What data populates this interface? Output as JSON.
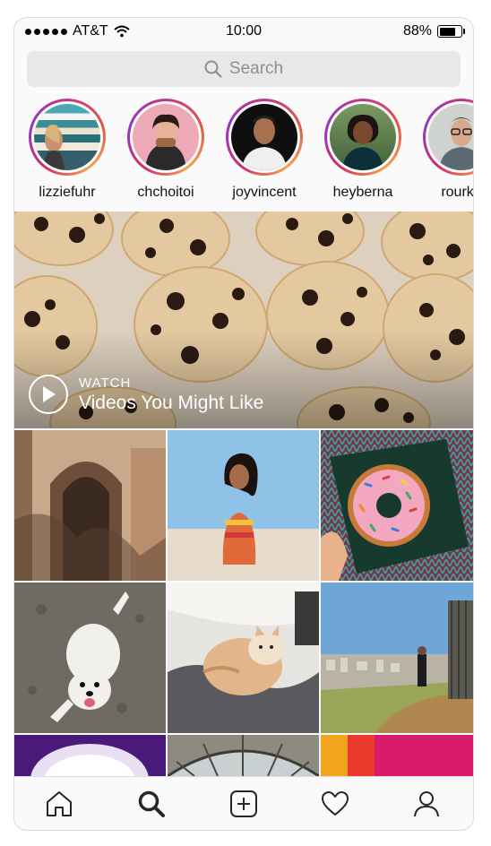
{
  "status_bar": {
    "carrier": "AT&T",
    "time": "10:00",
    "battery": "88%",
    "battery_level": 0.88
  },
  "search": {
    "placeholder": "Search",
    "icon": "search-icon"
  },
  "stories": [
    {
      "username": "lizziefuhr"
    },
    {
      "username": "chchoitoi"
    },
    {
      "username": "joyvincent"
    },
    {
      "username": "heyberna"
    },
    {
      "username": "rourke"
    }
  ],
  "featured": {
    "kicker": "WATCH",
    "title": "Videos You Might Like",
    "icon": "play-icon"
  },
  "tab_bar": {
    "items": [
      {
        "icon": "home-icon"
      },
      {
        "icon": "search-icon",
        "active": true
      },
      {
        "icon": "add-post-icon"
      },
      {
        "icon": "heart-icon"
      },
      {
        "icon": "profile-icon"
      }
    ]
  },
  "colors": {
    "story_ring": "#c1368a",
    "background": "#fafafa",
    "search_fill": "#e8e8e8"
  }
}
